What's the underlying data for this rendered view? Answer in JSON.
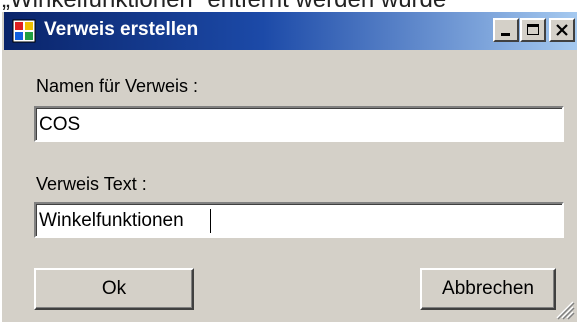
{
  "top_strip": {
    "text": "„Winkelfunktionen“ entfernt werden wurde"
  },
  "window": {
    "title": "Verweis erstellen",
    "icon": "app-window-icon",
    "controls": [
      "minimize-icon",
      "maximize-icon",
      "close-icon"
    ]
  },
  "form": {
    "name_label": "Namen für Verweis :",
    "name_value": "COS",
    "text_label": "Verweis Text :",
    "text_value": "Winkelfunktionen"
  },
  "buttons": {
    "ok": "Ok",
    "cancel": "Abbrechen"
  },
  "colors": {
    "titlebar_start": "#0a246a",
    "titlebar_end": "#a6caf0",
    "dialog_bg": "#d4d0c8"
  }
}
